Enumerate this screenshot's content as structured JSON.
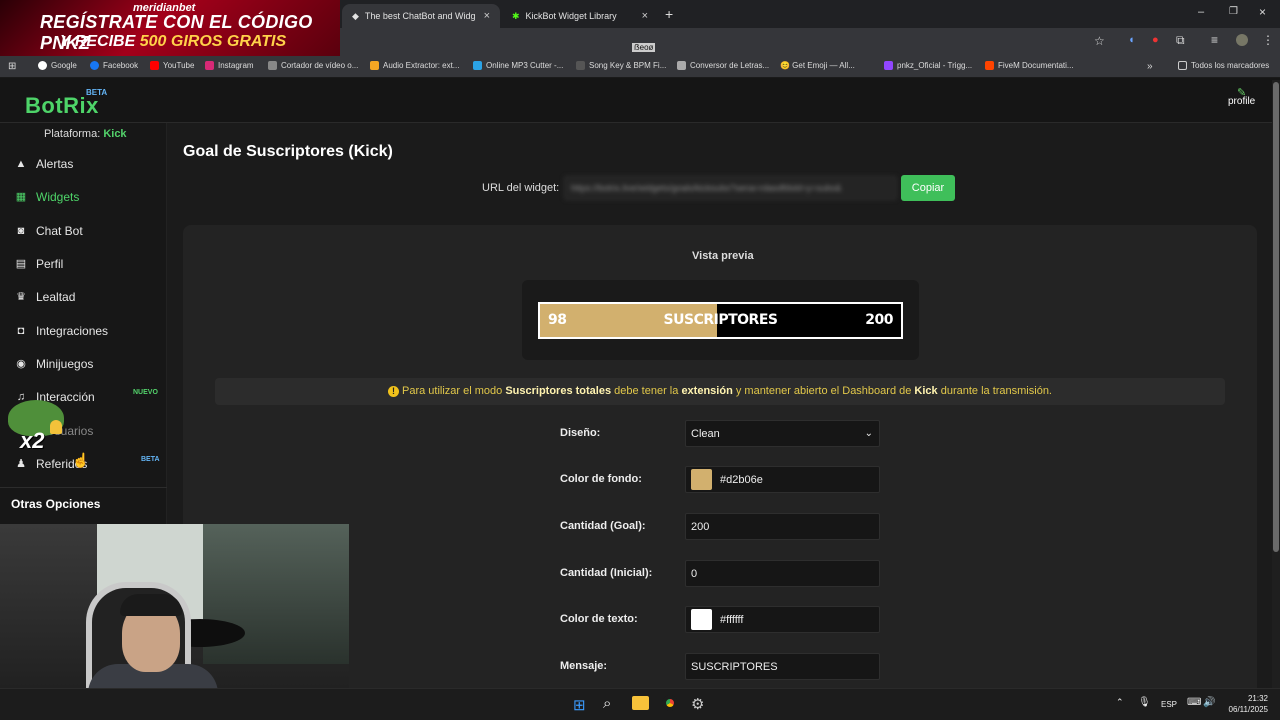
{
  "browser": {
    "tabs": [
      {
        "title": "The best ChatBot and Widgets",
        "active": true
      },
      {
        "title": "KickBot Widget Library",
        "active": false
      }
    ],
    "address_fragment": "ẞeoø",
    "bookmarks": [
      "Google",
      "Facebook",
      "YouTube",
      "Instagram",
      "Cortador de vídeo o...",
      "Audio Extractor: ext...",
      "Online MP3 Cutter -...",
      "Song Key & BPM Fi...",
      "Conversor de Letras...",
      "😊 Get Emoji — All...",
      "pnkz_Oficial - Trigg...",
      "FiveM Documentati..."
    ],
    "bookmarks_more": "»",
    "all_bookmarks": "Todos los marcadores"
  },
  "ad": {
    "brand": "meridianbet",
    "line1": "REGÍSTRATE CON EL CÓDIGO PNKZ",
    "line2_prefix": "Y RECIBE ",
    "line2_highlight": "500 GIROS GRATIS"
  },
  "app": {
    "logo": "BotRix",
    "logo_badge": "BETA",
    "profile_label": "profile",
    "platform_label": "Plataforma:",
    "platform_value": "Kick"
  },
  "sidebar": {
    "items": [
      {
        "label": "Alertas",
        "icon": "warning-icon",
        "active": false
      },
      {
        "label": "Widgets",
        "icon": "grid-icon",
        "active": true
      },
      {
        "label": "Chat Bot",
        "icon": "robot-icon",
        "active": false
      },
      {
        "label": "Perfil",
        "icon": "id-card-icon",
        "active": false
      },
      {
        "label": "Lealtad",
        "icon": "trophy-icon",
        "active": false
      },
      {
        "label": "Integraciones",
        "icon": "integration-icon",
        "active": false
      },
      {
        "label": "Minijuegos",
        "icon": "gamepad-icon",
        "active": false
      },
      {
        "label": "Interacción",
        "icon": "music-note-icon",
        "active": false,
        "badge": "NUEVO"
      },
      {
        "label": "Usuarios",
        "icon": "users-icon",
        "active": false
      },
      {
        "label": "Referidos",
        "icon": "user-plus-icon",
        "active": false,
        "badge": "BETA"
      }
    ],
    "section_title": "Otras Opciones"
  },
  "main": {
    "title": "Goal de Suscriptores (Kick)",
    "url_label": "URL del widget:",
    "url_value": "https://botrix.live/widgets/goals/kicksubs?sena=rdasdfdsld=y=subs&",
    "copy_button": "Copiar",
    "preview_label": "Vista previa",
    "preview": {
      "current": "98",
      "goal_display": "200",
      "message": "SUSCRIPTORES",
      "progress_fraction": 0.49,
      "fill_color": "#d2b06e",
      "text_color": "#ffffff"
    },
    "notice": {
      "part1": "Para utilizar el modo ",
      "bold1": "Suscriptores totales",
      "part2": " debe tener la ",
      "bold2": "extensión",
      "part3": " y mantener abierto el Dashboard de ",
      "bold3": "Kick",
      "part4": " durante la transmisión."
    },
    "form": {
      "design_label": "Diseño:",
      "design_value": "Clean",
      "bg_color_label": "Color de fondo:",
      "bg_color_value": "#d2b06e",
      "goal_label": "Cantidad (Goal):",
      "goal_value": "200",
      "initial_label": "Cantidad (Inicial):",
      "initial_value": "0",
      "text_color_label": "Color de texto:",
      "text_color_value": "#ffffff",
      "message_label": "Mensaje:",
      "message_value": "SUSCRIPTORES"
    }
  },
  "overlay": {
    "pepe_text": "x2"
  },
  "taskbar": {
    "language": "ESP",
    "time": "21:32",
    "date": "06/11/2025"
  }
}
